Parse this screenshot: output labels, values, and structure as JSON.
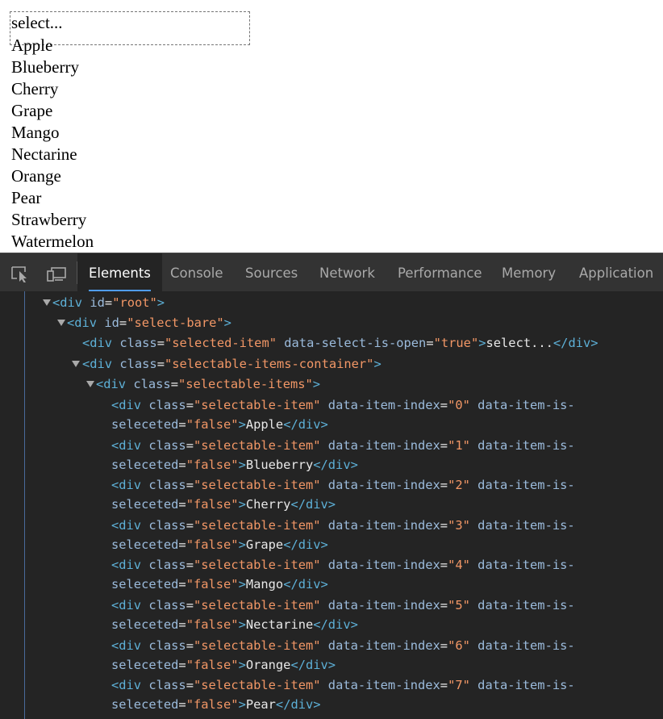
{
  "select": {
    "placeholder": "select...",
    "items": [
      "Apple",
      "Blueberry",
      "Cherry",
      "Grape",
      "Mango",
      "Nectarine",
      "Orange",
      "Pear",
      "Strawberry",
      "Watermelon"
    ]
  },
  "devtools": {
    "icons": [
      "inspect-element-icon",
      "device-toolbar-icon"
    ],
    "tabs": [
      "Elements",
      "Console",
      "Sources",
      "Network",
      "Performance",
      "Memory",
      "Application"
    ],
    "active_tab": "Elements",
    "colors": {
      "tag": "#5db0d7",
      "attr_name": "#9bbbdc",
      "attr_value": "#f29766",
      "text": "#e8e8e8",
      "tab_underline": "#4f9cf0"
    },
    "dom_lines": [
      {
        "tag": "div",
        "attrs": [
          [
            "id",
            "root"
          ]
        ],
        "text": "",
        "close": false,
        "expanded": true
      },
      {
        "tag": "div",
        "attrs": [
          [
            "id",
            "select-bare"
          ]
        ],
        "text": "",
        "close": false,
        "expanded": true
      },
      {
        "tag": "div",
        "attrs": [
          [
            "class",
            "selected-item"
          ],
          [
            "data-select-is-open",
            "true"
          ]
        ],
        "text": "select...",
        "close": true,
        "expanded": false
      },
      {
        "tag": "div",
        "attrs": [
          [
            "class",
            "selectable-items-container"
          ]
        ],
        "text": "",
        "close": false,
        "expanded": true
      },
      {
        "tag": "div",
        "attrs": [
          [
            "class",
            "selectable-items"
          ]
        ],
        "text": "",
        "close": false,
        "expanded": true
      },
      {
        "tag": "div",
        "attrs": [
          [
            "class",
            "selectable-item"
          ],
          [
            "data-item-index",
            "0"
          ],
          [
            "data-item-is-seleceted",
            "false"
          ]
        ],
        "text": "Apple",
        "close": true
      },
      {
        "tag": "div",
        "attrs": [
          [
            "class",
            "selectable-item"
          ],
          [
            "data-item-index",
            "1"
          ],
          [
            "data-item-is-seleceted",
            "false"
          ]
        ],
        "text": "Blueberry",
        "close": true
      },
      {
        "tag": "div",
        "attrs": [
          [
            "class",
            "selectable-item"
          ],
          [
            "data-item-index",
            "2"
          ],
          [
            "data-item-is-seleceted",
            "false"
          ]
        ],
        "text": "Cherry",
        "close": true
      },
      {
        "tag": "div",
        "attrs": [
          [
            "class",
            "selectable-item"
          ],
          [
            "data-item-index",
            "3"
          ],
          [
            "data-item-is-seleceted",
            "false"
          ]
        ],
        "text": "Grape",
        "close": true
      },
      {
        "tag": "div",
        "attrs": [
          [
            "class",
            "selectable-item"
          ],
          [
            "data-item-index",
            "4"
          ],
          [
            "data-item-is-seleceted",
            "false"
          ]
        ],
        "text": "Mango",
        "close": true
      },
      {
        "tag": "div",
        "attrs": [
          [
            "class",
            "selectable-item"
          ],
          [
            "data-item-index",
            "5"
          ],
          [
            "data-item-is-seleceted",
            "false"
          ]
        ],
        "text": "Nectarine",
        "close": true
      },
      {
        "tag": "div",
        "attrs": [
          [
            "class",
            "selectable-item"
          ],
          [
            "data-item-index",
            "6"
          ],
          [
            "data-item-is-seleceted",
            "false"
          ]
        ],
        "text": "Orange",
        "close": true
      },
      {
        "tag": "div",
        "attrs": [
          [
            "class",
            "selectable-item"
          ],
          [
            "data-item-index",
            "7"
          ],
          [
            "data-item-is-seleceted",
            "false"
          ]
        ],
        "text": "Pear",
        "close": true
      }
    ]
  }
}
